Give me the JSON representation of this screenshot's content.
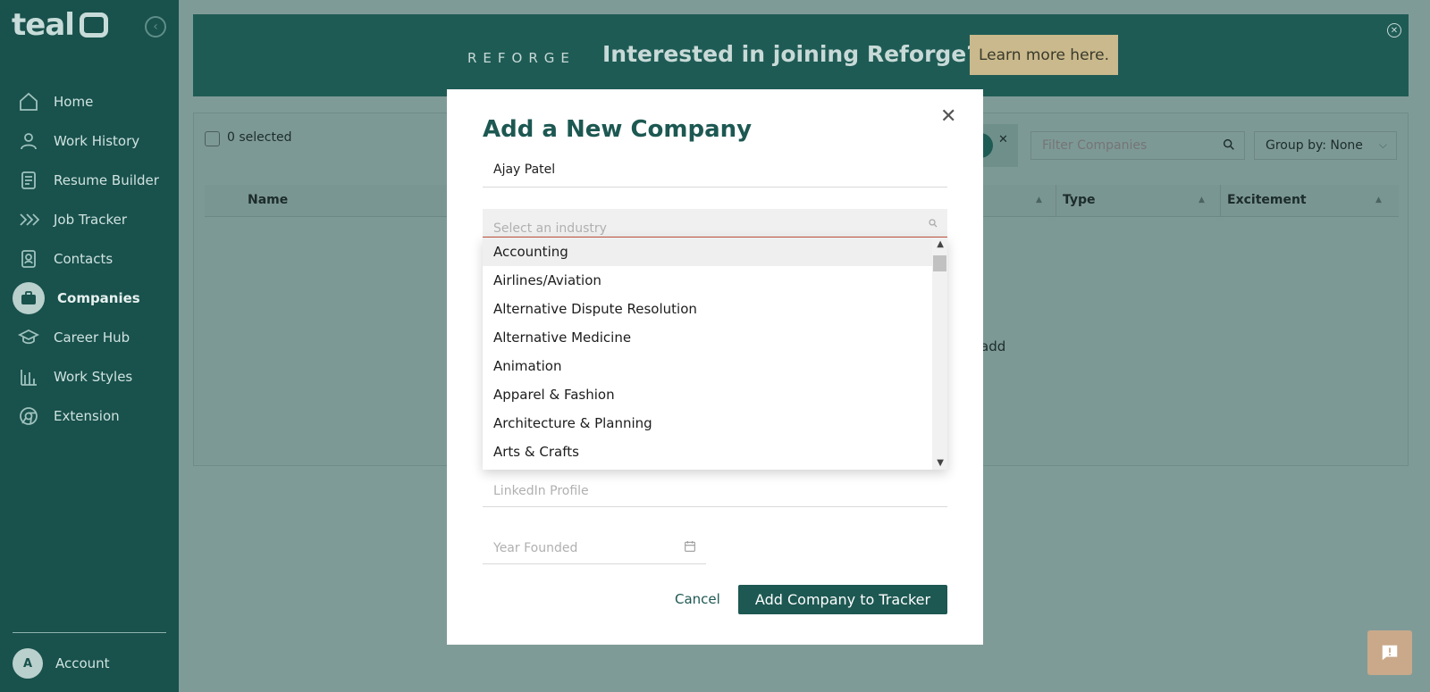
{
  "app": {
    "logo_text": "teal"
  },
  "sidebar": {
    "items": [
      {
        "label": "Home",
        "icon": "home-icon"
      },
      {
        "label": "Work History",
        "icon": "person-icon"
      },
      {
        "label": "Resume Builder",
        "icon": "document-icon"
      },
      {
        "label": "Job Tracker",
        "icon": "chevrons-icon"
      },
      {
        "label": "Contacts",
        "icon": "contact-card-icon"
      },
      {
        "label": "Companies",
        "icon": "briefcase-icon",
        "active": true
      },
      {
        "label": "Career Hub",
        "icon": "graduation-cap-icon"
      },
      {
        "label": "Work Styles",
        "icon": "bar-chart-icon"
      },
      {
        "label": "Extension",
        "icon": "chrome-icon"
      }
    ],
    "account": {
      "avatar_letter": "A",
      "label": "Account"
    }
  },
  "banner": {
    "brand": "REFORGE",
    "headline": "Interested in joining Reforge?",
    "cta": "Learn more here."
  },
  "table": {
    "selected_count": "0 selected",
    "filter_placeholder": "Filter Companies",
    "group_by": "Group by: None",
    "columns": [
      "Name",
      "Type",
      "Excitement"
    ],
    "empty_fragment": "add"
  },
  "modal": {
    "title": "Add a New Company",
    "company_name_value": "Ajay Patel",
    "industry_placeholder": "Select an industry",
    "industry_options": [
      "Accounting",
      "Airlines/Aviation",
      "Alternative Dispute Resolution",
      "Alternative Medicine",
      "Animation",
      "Apparel & Fashion",
      "Architecture & Planning",
      "Arts & Crafts"
    ],
    "highlighted_option": "Accounting",
    "linkedin_placeholder": "LinkedIn Profile",
    "year_placeholder": "Year Founded",
    "cancel_label": "Cancel",
    "submit_label": "Add Company to Tracker"
  },
  "colors": {
    "sidebar_bg": "#19514c",
    "brand_green": "#1d5852",
    "banner_cta_bg": "#c9b98c",
    "overlay_bg": "#7f9b98",
    "feedback_bg": "#c9a98a"
  }
}
